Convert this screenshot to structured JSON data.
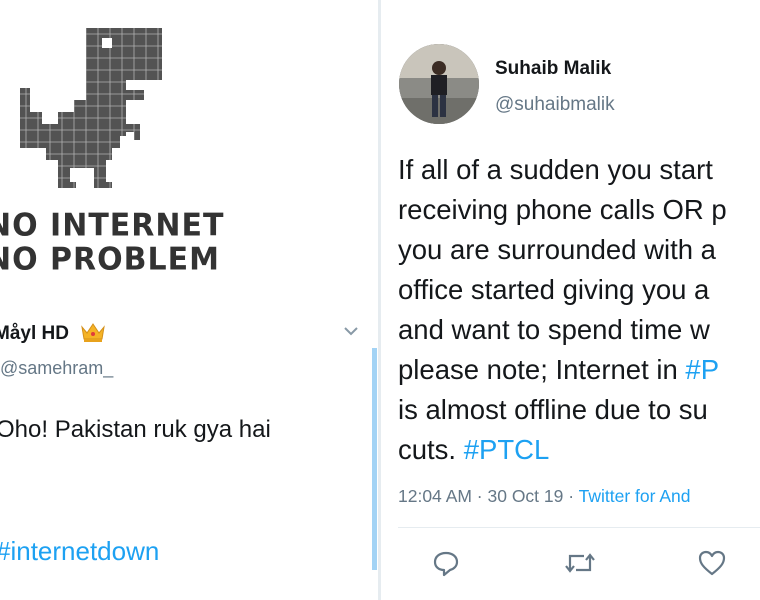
{
  "left": {
    "meme_line1": "NO INTERNET",
    "meme_line2": "NO PROBLEM",
    "user_name": "Måyl HD",
    "handle": "@samehram_",
    "text": "Oho! Pakistan ruk gya hai",
    "hashtag": "#internetdown"
  },
  "right": {
    "user_name": "Suhaib Malik",
    "handle": "@suhaibmalik",
    "lines": [
      {
        "parts": [
          {
            "t": "If all of a sudden you start"
          }
        ]
      },
      {
        "parts": [
          {
            "t": "receiving phone calls OR p"
          }
        ]
      },
      {
        "parts": [
          {
            "t": "you are surrounded with a"
          }
        ]
      },
      {
        "parts": [
          {
            "t": "office started giving you a"
          }
        ]
      },
      {
        "parts": [
          {
            "t": "and want to spend time w"
          }
        ]
      },
      {
        "parts": [
          {
            "t": "please note; Internet in "
          },
          {
            "t": "#P",
            "ht": true
          }
        ]
      },
      {
        "parts": [
          {
            "t": "is almost offline due to su"
          }
        ]
      },
      {
        "parts": [
          {
            "t": "cuts. "
          },
          {
            "t": "#PTCL",
            "ht": true
          }
        ]
      }
    ],
    "meta_time": "12:04 AM · 30 Oct 19 · ",
    "meta_source": "Twitter for And",
    "icons": [
      "reply-icon",
      "retweet-icon",
      "like-icon"
    ]
  }
}
